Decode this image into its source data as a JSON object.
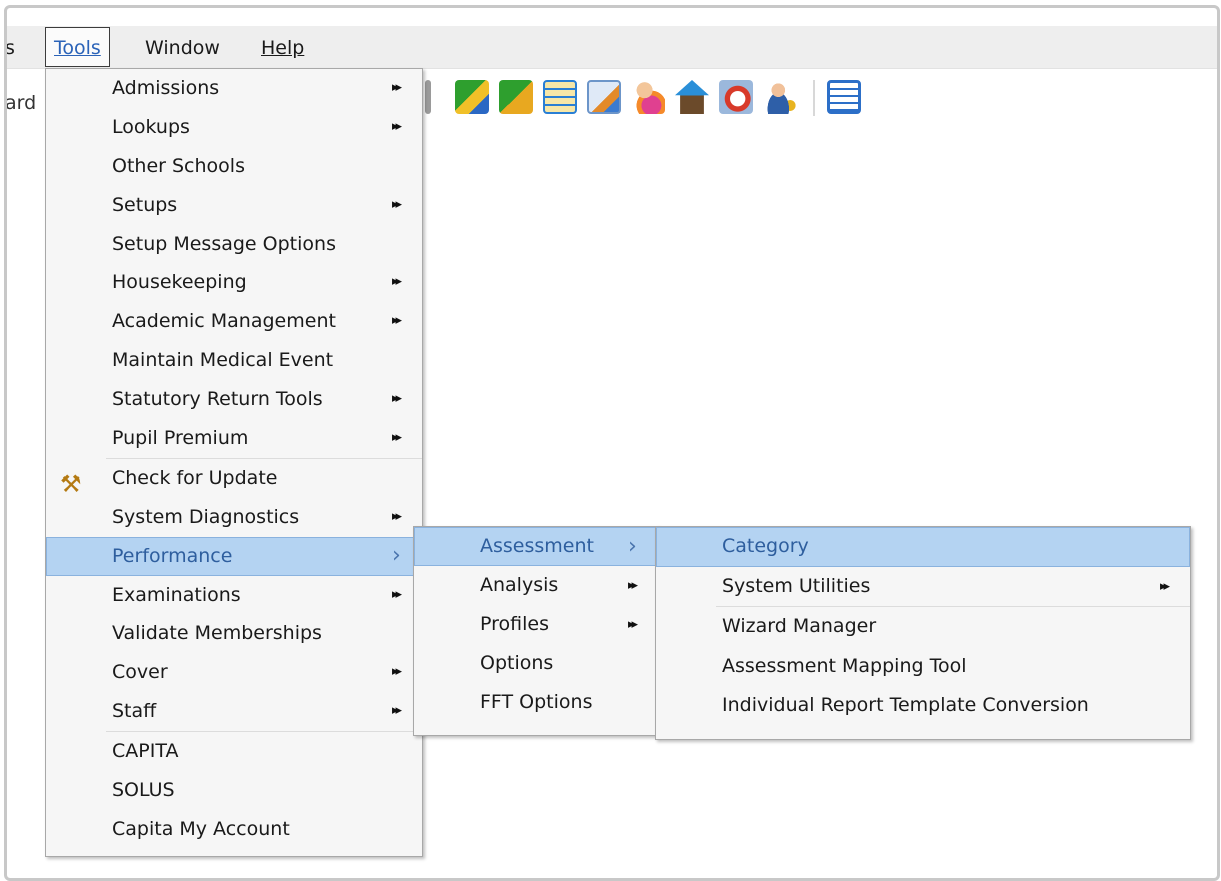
{
  "menubar": {
    "cut_label": "s",
    "items": [
      {
        "label": "Tools"
      },
      {
        "label": "Window"
      },
      {
        "label": "Help"
      }
    ]
  },
  "left_stub": "ard",
  "toolbar": {
    "icons": [
      "toolbar-edge-icon",
      "chart-pencil-icon",
      "chart-gear-icon",
      "document-grid-icon",
      "edit-document-icon",
      "user-group-icon",
      "home-arrow-icon",
      "clock-calendar-icon",
      "user-key-icon",
      "spreadsheet-grid-icon"
    ]
  },
  "tools_menu": {
    "items": [
      {
        "label": "Admissions",
        "submenu": true
      },
      {
        "label": "Lookups",
        "submenu": true
      },
      {
        "label": "Other Schools",
        "submenu": false
      },
      {
        "label": "Setups",
        "submenu": true
      },
      {
        "label": "Setup Message Options",
        "submenu": false
      },
      {
        "label": "Housekeeping",
        "submenu": true
      },
      {
        "label": "Academic Management",
        "submenu": true
      },
      {
        "label": "Maintain Medical Event",
        "submenu": false
      },
      {
        "label": "Statutory Return Tools",
        "submenu": true
      },
      {
        "label": "Pupil Premium",
        "submenu": true
      },
      {
        "label": "Check for Update",
        "submenu": false
      },
      {
        "label": "System Diagnostics",
        "submenu": true
      },
      {
        "label": "Performance",
        "submenu": true,
        "selected": true
      },
      {
        "label": "Examinations",
        "submenu": true
      },
      {
        "label": "Validate Memberships",
        "submenu": false
      },
      {
        "label": "Cover",
        "submenu": true
      },
      {
        "label": "Staff",
        "submenu": true
      },
      {
        "label": "CAPITA",
        "submenu": false
      },
      {
        "label": "SOLUS",
        "submenu": false
      },
      {
        "label": "Capita My Account",
        "submenu": false
      }
    ]
  },
  "performance_menu": {
    "items": [
      {
        "label": "Assessment",
        "submenu": true,
        "selected": true
      },
      {
        "label": "Analysis",
        "submenu": true
      },
      {
        "label": "Profiles",
        "submenu": true
      },
      {
        "label": "Options",
        "submenu": false
      },
      {
        "label": "FFT Options",
        "submenu": false
      }
    ]
  },
  "assessment_menu": {
    "items": [
      {
        "label": "Category",
        "submenu": false,
        "selected": true
      },
      {
        "label": "System Utilities",
        "submenu": true
      },
      {
        "label": "Wizard Manager",
        "submenu": false
      },
      {
        "label": "Assessment Mapping Tool",
        "submenu": false
      },
      {
        "label": "Individual Report Template Conversion",
        "submenu": false
      }
    ]
  },
  "colors": {
    "selection_bg": "#b4d3f2",
    "selection_text": "#2e5e9e",
    "menu_bg": "#f6f6f6",
    "menubar_bg": "#eeeeee"
  }
}
